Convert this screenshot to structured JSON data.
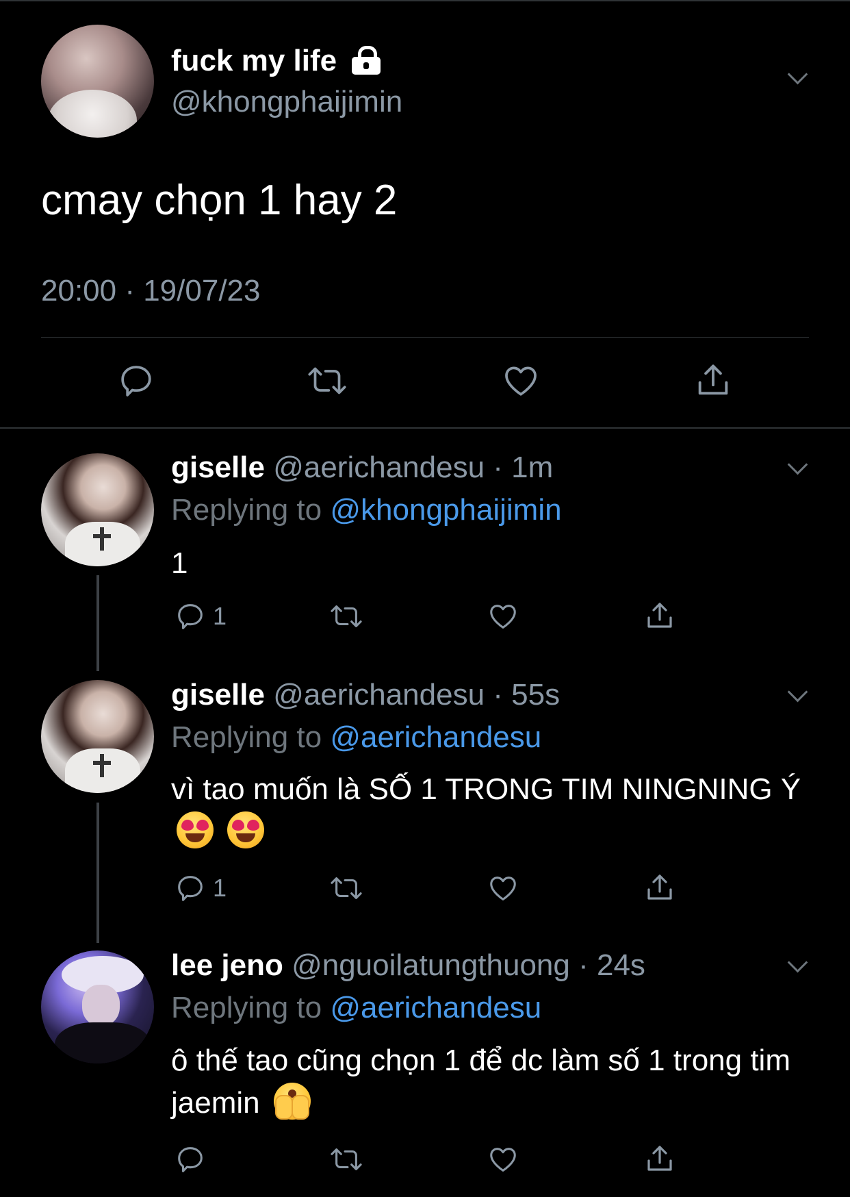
{
  "main_tweet": {
    "display_name": "fuck my life",
    "handle": "@khongphaijimin",
    "text": "cmay chọn 1 hay 2",
    "timestamp": "20:00 · 19/07/23"
  },
  "replies": [
    {
      "display_name": "giselle",
      "handle": "@aerichandesu",
      "time": "1m",
      "replying_prefix": "Replying to",
      "replying_to": "@khongphaijimin",
      "text": "1",
      "emojis": [],
      "reply_count": "1"
    },
    {
      "display_name": "giselle",
      "handle": "@aerichandesu",
      "time": "55s",
      "replying_prefix": "Replying to",
      "replying_to": "@aerichandesu",
      "text": "vì tao muốn là SỐ 1 TRONG TIM NINGNING Ý",
      "emojis": [
        "smiling-face-with-heart-eyes",
        "smiling-face-with-heart-eyes"
      ],
      "reply_count": "1"
    },
    {
      "display_name": "lee jeno",
      "handle": "@nguoilatungthuong",
      "time": "24s",
      "replying_prefix": "Replying to",
      "replying_to": "@aerichandesu",
      "text": "ô thế tao cũng chọn 1 để dc làm số 1 trong tim jaemin",
      "emojis": [
        "face-with-open-eyes-and-hand-over-mouth"
      ],
      "reply_count": ""
    }
  ],
  "separator": " · ",
  "colors": {
    "background": "#000000",
    "text_primary": "#ffffff",
    "text_secondary": "#8b98a5",
    "mention": "#4a99e9",
    "divider": "#2f3336"
  }
}
